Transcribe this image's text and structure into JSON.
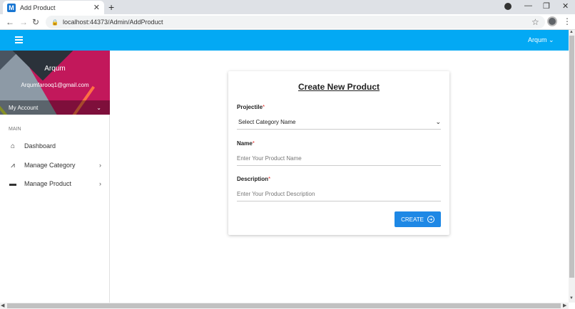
{
  "browser": {
    "tab_title": "Add Product",
    "tab_favicon": "M",
    "tab_close": "✕",
    "new_tab": "+",
    "url": "localhost:44373/Admin/AddProduct",
    "win_min": "—",
    "win_restore": "❐",
    "win_close": "✕"
  },
  "header": {
    "user": "Arqum ⌄"
  },
  "sidebar": {
    "profile_name": "Arqum",
    "profile_email": "Arqumfarooq1@gmail.com",
    "account_label": "My Account",
    "section_label": "MAIN",
    "items": [
      {
        "label": "Dashboard",
        "icon": "home-icon"
      },
      {
        "label": "Manage Category",
        "icon": "graph-icon"
      },
      {
        "label": "Manage Product",
        "icon": "box-icon"
      }
    ]
  },
  "form": {
    "title": "Create New Product",
    "projectile_label": "Projectile",
    "required_mark": "*",
    "category_select_value": "Select Category Name",
    "name_label": "Name",
    "name_placeholder": "Enter Your Product Name",
    "description_label": "Description",
    "description_placeholder": "Enter Your Product Description",
    "create_button": "CREATE"
  },
  "colors": {
    "header": "#03a9f4",
    "button": "#1e88e5",
    "required": "#e53935"
  }
}
